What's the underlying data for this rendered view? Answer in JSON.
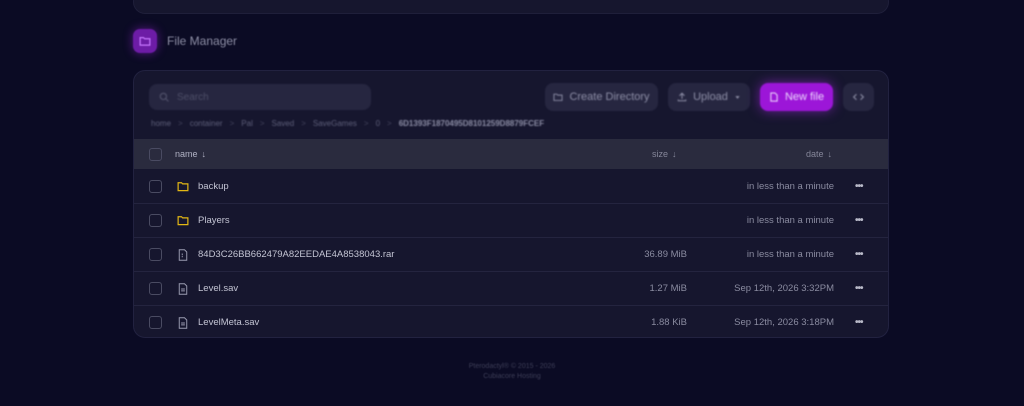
{
  "section": {
    "title": "File Manager",
    "icon": "folder-icon"
  },
  "search": {
    "placeholder": "Search"
  },
  "toolbar": {
    "create_directory": "Create Directory",
    "upload": "Upload",
    "new_file": "New file",
    "code_icon": "code-icon"
  },
  "breadcrumbs": {
    "items": [
      "home",
      "container",
      "Pal",
      "Saved",
      "SaveGames",
      "0"
    ],
    "current": "6D1393F1870495D8101259D8879FCEF"
  },
  "table": {
    "headers": {
      "name": "name",
      "size": "size",
      "date": "date"
    },
    "sort_indicator": "↓",
    "rows": [
      {
        "type": "folder",
        "name": "backup",
        "size": "",
        "date": "in less than a minute"
      },
      {
        "type": "folder",
        "name": "Players",
        "size": "",
        "date": "in less than a minute"
      },
      {
        "type": "archive",
        "name": "84D3C26BB662479A82EEDAE4A8538043.rar",
        "size": "36.89 MiB",
        "date": "in less than a minute"
      },
      {
        "type": "file",
        "name": "Level.sav",
        "size": "1.27 MiB",
        "date": "Sep 12th, 2026 3:32PM"
      },
      {
        "type": "file",
        "name": "LevelMeta.sav",
        "size": "1.88 KiB",
        "date": "Sep 12th, 2026 3:18PM"
      }
    ]
  },
  "footer": {
    "line1": "Pterodactyl® © 2015 - 2026",
    "line2": "Cubiacore Hosting"
  },
  "colors": {
    "background": "#0b0b24",
    "panel": "#16162e",
    "accent": "#9c16d8",
    "folder": "#e2b714"
  }
}
